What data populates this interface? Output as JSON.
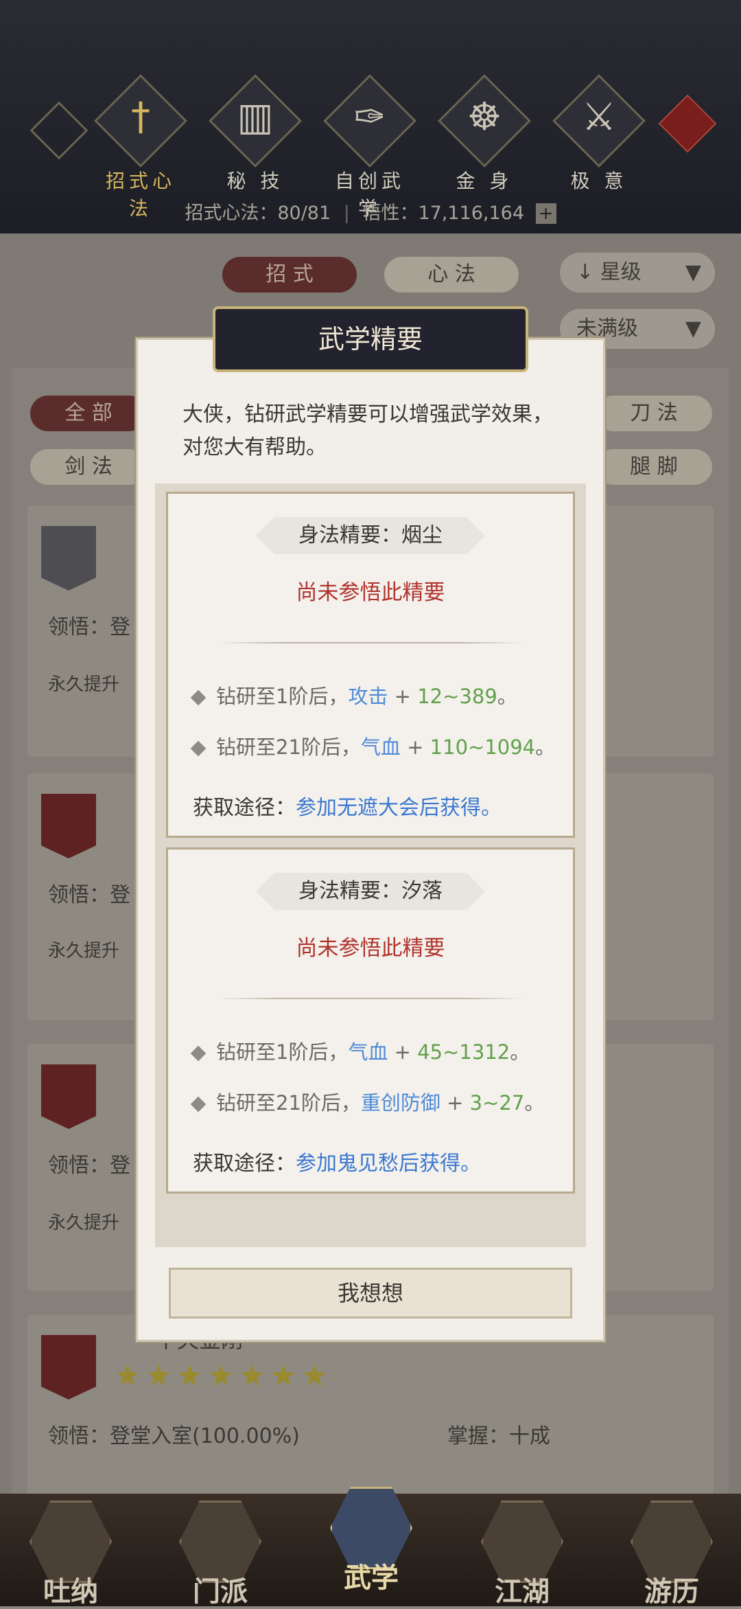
{
  "header": {
    "nav": [
      {
        "label": "招式心法",
        "icon": "sword-icon",
        "active": true
      },
      {
        "label": "秘 技",
        "icon": "book-icon"
      },
      {
        "label": "自创武学",
        "icon": "scroll-icon"
      },
      {
        "label": "金 身",
        "icon": "meditation-icon"
      },
      {
        "label": "极 意",
        "icon": "martial-pose-icon"
      }
    ],
    "stats": {
      "moves_label": "招式心法：80/81",
      "insight_label": "悟性：17,116,164",
      "plus": "+"
    }
  },
  "filters": {
    "tab_moves": "招 式",
    "tab_mind": "心 法",
    "sort": "星级",
    "level_filter": "未满级",
    "cat_all": "全 部",
    "cat_sword": "剑 法",
    "cat_blade": "刀 法",
    "cat_leg": "腿 脚"
  },
  "background_cards": {
    "comprehend": "领悟：登",
    "permanent": "永久提升",
    "last_card": {
      "name": "不灭金刚",
      "comprehend": "领悟：登堂入室(100.00%)",
      "mastery": "掌握：十成",
      "stars": "★★★★★★★"
    }
  },
  "modal": {
    "title": "武学精要",
    "description": "大侠，钻研武学精要可以增强武学效果，对您大有帮助。",
    "entries": [
      {
        "name": "身法精要：烟尘",
        "status": "尚未参悟此精要",
        "effects": [
          {
            "prefix": "钻研至1阶后，",
            "stat": "攻击",
            "plus": " + ",
            "value": "12~389",
            "end": "。"
          },
          {
            "prefix": "钻研至21阶后，",
            "stat": "气血",
            "plus": " + ",
            "value": "110~1094",
            "end": "。"
          }
        ],
        "source_label": "获取途径：",
        "source_link": "参加无遮大会后获得。"
      },
      {
        "name": "身法精要：汐落",
        "status": "尚未参悟此精要",
        "effects": [
          {
            "prefix": "钻研至1阶后，",
            "stat": "气血",
            "plus": " + ",
            "value": "45~1312",
            "end": "。"
          },
          {
            "prefix": "钻研至21阶后，",
            "stat": "重创防御",
            "plus": " + ",
            "value": "3~27",
            "end": "。"
          }
        ],
        "source_label": "获取途径：",
        "source_link": "参加鬼见愁后获得。"
      }
    ],
    "button": "我想想"
  },
  "bottom_nav": [
    {
      "label": "吐纳"
    },
    {
      "label": "门派"
    },
    {
      "label": "武学",
      "active": true
    },
    {
      "label": "江湖"
    },
    {
      "label": "游历"
    }
  ],
  "colors": {
    "accent_gold": "#d7b660",
    "status_red": "#b0342e",
    "stat_blue": "#4f8ad6",
    "value_green": "#62a04b"
  }
}
